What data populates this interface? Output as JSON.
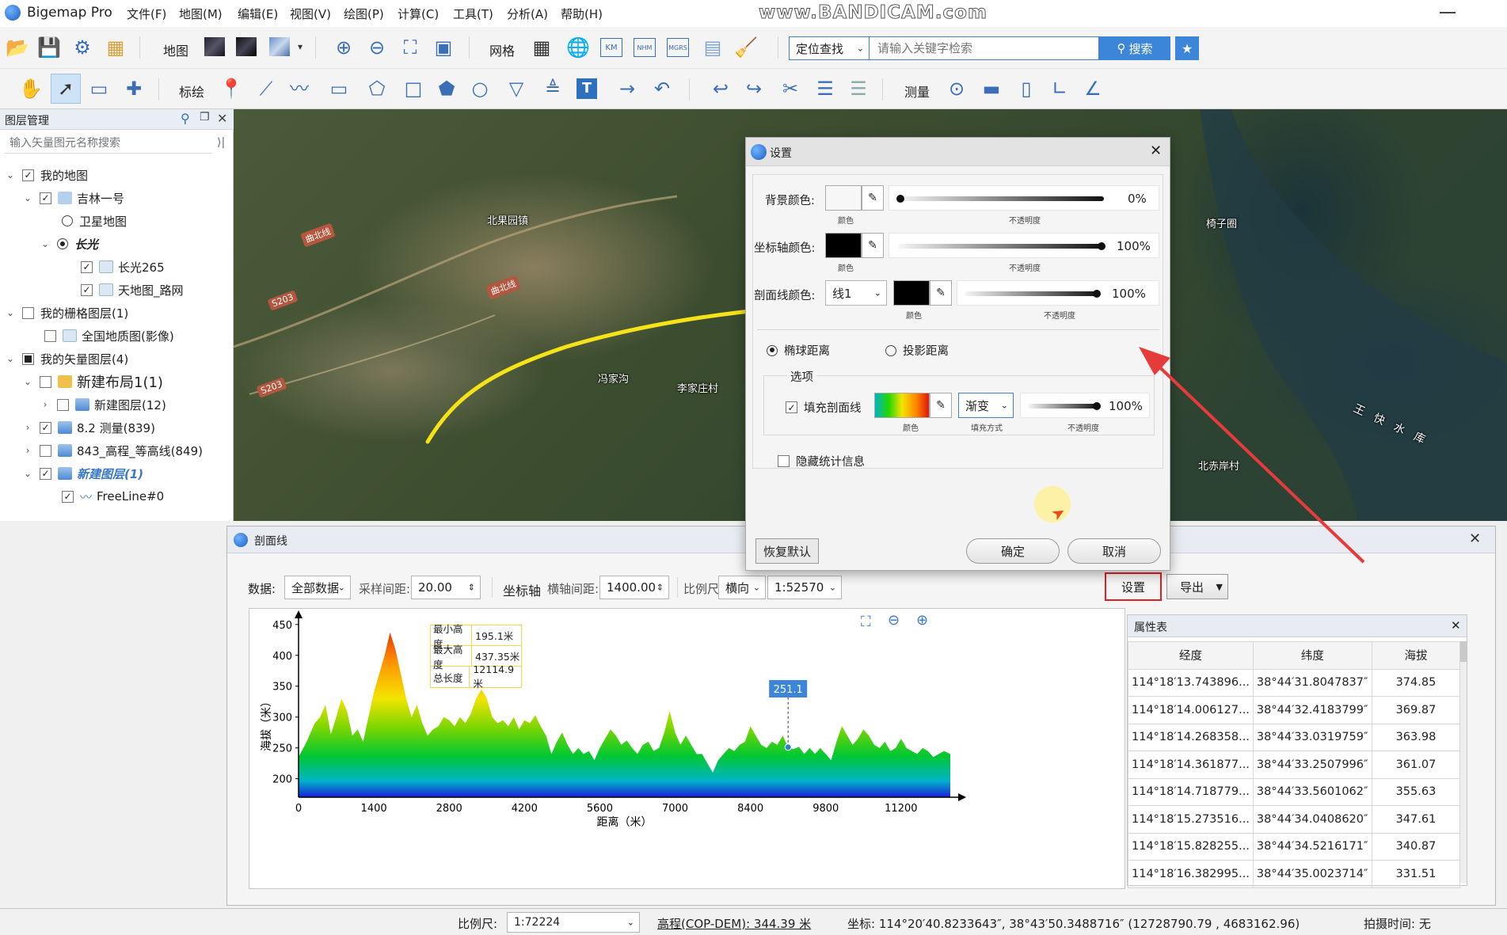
{
  "app": {
    "title": "Bigemap Pro",
    "watermark": "www.BANDICAM.com",
    "menu": [
      "文件(F)",
      "地图(M)",
      "编辑(E)",
      "视图(V)",
      "绘图(P)",
      "计算(C)",
      "工具(T)",
      "分析(A)",
      "帮助(H)"
    ]
  },
  "toolbar1": {
    "map_label": "地图",
    "grid_label": "网格",
    "grid_tags": [
      "KM",
      "NHM",
      "MGRS"
    ],
    "locate_select": "定位查找",
    "search_placeholder": "请输入关键字检索",
    "search_button": "搜索"
  },
  "toolbar2": {
    "annotate_label": "标绘",
    "measure_label": "测量",
    "text_glyph": "T"
  },
  "layer_panel": {
    "title": "图层管理",
    "search_placeholder": "输入矢量图元名称搜索",
    "items": [
      {
        "label": "我的地图",
        "checked": true
      },
      {
        "label": "吉林一号",
        "checked": true
      },
      {
        "label": "卫星地图"
      },
      {
        "label": "长光"
      },
      {
        "label": "长光265",
        "checked": true
      },
      {
        "label": "天地图_路网",
        "checked": true
      },
      {
        "label": "我的栅格图层(1)",
        "checked": false
      },
      {
        "label": "全国地质图(影像)",
        "checked": false
      },
      {
        "label": "我的矢量图层(4)",
        "checked": "partial"
      },
      {
        "label": "新建布局1(1)",
        "checked": false
      },
      {
        "label": "新建图层(12)",
        "checked": false
      },
      {
        "label": "8.2 测量(839)",
        "checked": true
      },
      {
        "label": "843_高程_等高线(849)",
        "checked": false
      },
      {
        "label": "新建图层(1)",
        "checked": true
      },
      {
        "label": "FreeLine#0",
        "checked": true
      }
    ]
  },
  "map": {
    "labels": [
      "北果园镇",
      "李家庄村",
      "冯家沟",
      "椅子圈",
      "北赤岸村"
    ],
    "road_tags": [
      "S203",
      "S203"
    ],
    "road_names": [
      "曲北线",
      "曲北线",
      "王快水库"
    ]
  },
  "settings_dialog": {
    "title": "设置",
    "bg_color_label": "背景颜色:",
    "bg_opacity": "0%",
    "axis_color_label": "坐标轴颜色:",
    "axis_opacity": "100%",
    "profile_color_label": "剖面线颜色:",
    "profile_line_select": "线1",
    "profile_opacity": "100%",
    "color_caption": "颜色",
    "opacity_caption": "不透明度",
    "fill_mode_caption": "填充方式",
    "ellipsoid_distance": "椭球距离",
    "projected_distance": "投影距离",
    "options_label": "选项",
    "fill_profile_label": "填充剖面线",
    "fill_mode_select": "渐变",
    "fill_opacity": "100%",
    "hide_stats_label": "隐藏统计信息",
    "restore_button": "恢复默认",
    "ok_button": "确定",
    "cancel_button": "取消",
    "colors": {
      "bg": "#f7f7f7",
      "axis": "#000000",
      "profile": "#000000"
    }
  },
  "profile_window": {
    "title": "剖面线",
    "data_label": "数据:",
    "data_select": "全部数据",
    "sample_label": "采样间距:",
    "sample_value": "20.00",
    "axis_label": "坐标轴",
    "h_interval_label": "横轴间距:",
    "h_interval_value": "1400.00",
    "scale_label": "比例尺",
    "orient_select": "横向",
    "scale_select": "1:52570",
    "settings_button": "设置",
    "export_button": "导出",
    "stats": [
      {
        "k": "最小高度",
        "v": "195.1米"
      },
      {
        "k": "最大高度",
        "v": "437.35米"
      },
      {
        "k": "总长度",
        "v": "12114.9米"
      }
    ],
    "cursor_value": "251.1"
  },
  "chart_data": {
    "type": "area",
    "xlabel": "距离（米）",
    "ylabel": "海拔（米）",
    "x_ticks": [
      0,
      1400,
      2800,
      4200,
      5600,
      7000,
      8400,
      9800,
      11200
    ],
    "y_ticks": [
      200,
      250,
      300,
      350,
      400,
      450
    ],
    "xlim": [
      0,
      12114.9
    ],
    "ylim": [
      170,
      460
    ],
    "fill": "gradient",
    "cursor": {
      "x": 9100,
      "y": 251.1
    },
    "points": [
      [
        0,
        235
      ],
      [
        150,
        260
      ],
      [
        300,
        290
      ],
      [
        400,
        300
      ],
      [
        500,
        320
      ],
      [
        600,
        272
      ],
      [
        700,
        300
      ],
      [
        800,
        330
      ],
      [
        900,
        310
      ],
      [
        1000,
        270
      ],
      [
        1100,
        280
      ],
      [
        1200,
        260
      ],
      [
        1300,
        300
      ],
      [
        1400,
        340
      ],
      [
        1500,
        370
      ],
      [
        1600,
        400
      ],
      [
        1700,
        437
      ],
      [
        1800,
        410
      ],
      [
        1900,
        370
      ],
      [
        2000,
        330
      ],
      [
        2100,
        300
      ],
      [
        2200,
        320
      ],
      [
        2300,
        290
      ],
      [
        2400,
        270
      ],
      [
        2500,
        280
      ],
      [
        2600,
        285
      ],
      [
        2700,
        300
      ],
      [
        2800,
        295
      ],
      [
        2900,
        285
      ],
      [
        3000,
        300
      ],
      [
        3100,
        290
      ],
      [
        3200,
        305
      ],
      [
        3300,
        330
      ],
      [
        3400,
        345
      ],
      [
        3500,
        330
      ],
      [
        3600,
        300
      ],
      [
        3700,
        290
      ],
      [
        3800,
        295
      ],
      [
        3900,
        285
      ],
      [
        4000,
        300
      ],
      [
        4100,
        280
      ],
      [
        4200,
        295
      ],
      [
        4300,
        290
      ],
      [
        4400,
        303
      ],
      [
        4500,
        285
      ],
      [
        4600,
        270
      ],
      [
        4700,
        240
      ],
      [
        4800,
        260
      ],
      [
        4900,
        275
      ],
      [
        5000,
        255
      ],
      [
        5100,
        240
      ],
      [
        5200,
        250
      ],
      [
        5300,
        240
      ],
      [
        5400,
        245
      ],
      [
        5500,
        230
      ],
      [
        5600,
        250
      ],
      [
        5700,
        265
      ],
      [
        5800,
        280
      ],
      [
        5900,
        270
      ],
      [
        6000,
        255
      ],
      [
        6100,
        262
      ],
      [
        6200,
        250
      ],
      [
        6300,
        240
      ],
      [
        6400,
        255
      ],
      [
        6500,
        260
      ],
      [
        6600,
        245
      ],
      [
        6700,
        250
      ],
      [
        6800,
        275
      ],
      [
        6900,
        310
      ],
      [
        7000,
        275
      ],
      [
        7100,
        255
      ],
      [
        7200,
        270
      ],
      [
        7300,
        255
      ],
      [
        7400,
        240
      ],
      [
        7500,
        240
      ],
      [
        7600,
        225
      ],
      [
        7700,
        210
      ],
      [
        7800,
        230
      ],
      [
        7900,
        240
      ],
      [
        8000,
        250
      ],
      [
        8100,
        245
      ],
      [
        8200,
        255
      ],
      [
        8300,
        260
      ],
      [
        8400,
        285
      ],
      [
        8500,
        270
      ],
      [
        8600,
        255
      ],
      [
        8700,
        250
      ],
      [
        8800,
        260
      ],
      [
        8900,
        255
      ],
      [
        9000,
        270
      ],
      [
        9100,
        251
      ],
      [
        9200,
        248
      ],
      [
        9300,
        252
      ],
      [
        9400,
        240
      ],
      [
        9500,
        250
      ],
      [
        9600,
        240
      ],
      [
        9700,
        250
      ],
      [
        9800,
        240
      ],
      [
        9900,
        230
      ],
      [
        10000,
        260
      ],
      [
        10100,
        285
      ],
      [
        10200,
        270
      ],
      [
        10300,
        255
      ],
      [
        10400,
        265
      ],
      [
        10500,
        280
      ],
      [
        10600,
        270
      ],
      [
        10700,
        255
      ],
      [
        10800,
        250
      ],
      [
        10900,
        260
      ],
      [
        11000,
        245
      ],
      [
        11100,
        250
      ],
      [
        11200,
        265
      ],
      [
        11300,
        250
      ],
      [
        11400,
        245
      ],
      [
        11500,
        240
      ],
      [
        11600,
        250
      ],
      [
        11700,
        245
      ],
      [
        11800,
        235
      ],
      [
        11900,
        240
      ],
      [
        12000,
        245
      ],
      [
        12114.9,
        240
      ]
    ]
  },
  "attr_table": {
    "title": "属性表",
    "columns": [
      "经度",
      "纬度",
      "海拔"
    ],
    "rows": [
      [
        "114°18′13.743896...",
        "38°44′31.8047837″",
        "374.85"
      ],
      [
        "114°18′14.006127...",
        "38°44′32.4183799″",
        "369.87"
      ],
      [
        "114°18′14.268358...",
        "38°44′33.0319759″",
        "363.98"
      ],
      [
        "114°18′14.361877...",
        "38°44′33.2507996″",
        "361.07"
      ],
      [
        "114°18′14.718779...",
        "38°44′33.5601062″",
        "355.63"
      ],
      [
        "114°18′15.273516...",
        "38°44′34.0408620″",
        "347.61"
      ],
      [
        "114°18′15.828255...",
        "38°44′34.5216171″",
        "340.87"
      ],
      [
        "114°18′16.382995...",
        "38°44′35.0023714″",
        "331.51"
      ]
    ]
  },
  "status": {
    "scale_label": "比例尺:",
    "scale_value": "1:72224",
    "elevation": "高程(COP-DEM): 344.39 米",
    "coords": "坐标: 114°20′40.8233643″, 38°43′50.3488716″ (12728790.79 , 4683162.96)",
    "capture_time": "拍摄时间: 无"
  }
}
